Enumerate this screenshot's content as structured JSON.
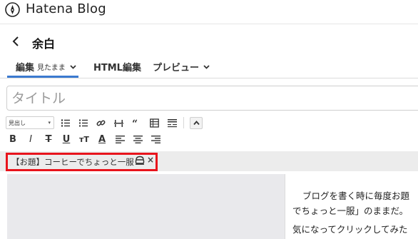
{
  "header": {
    "brand": "Hatena Blog",
    "icon": "hatena-pen-icon"
  },
  "page": {
    "title": "余白",
    "back_icon": "chevron-left-icon"
  },
  "tabs": [
    {
      "label": "編集",
      "sub": "見たまま",
      "active": true
    },
    {
      "label": "HTML編集",
      "active": false
    },
    {
      "label": "プレビュー",
      "active": false
    }
  ],
  "editor": {
    "title_placeholder": "タイトル",
    "heading_select": "見出し",
    "accent_color": "#3b7ad0",
    "highlight_color": "#e8141c"
  },
  "toolbar": {
    "row1": [
      "bulleted-list-icon",
      "numbered-list-icon",
      "link-icon",
      "separator-icon",
      "quote-icon",
      "table-icon",
      "more-icon",
      "collapse-icon"
    ],
    "row2": {
      "bold": "B",
      "italic": "I",
      "strike": "T",
      "underline": "U",
      "font_size": "тT",
      "color": "A",
      "icons": [
        "align-left-icon",
        "align-center-icon",
        "align-right-icon"
      ]
    }
  },
  "topic_tag": {
    "label": "【お題】コーヒーでちょっと一服",
    "icon": "coffee-cup-icon",
    "close": "×"
  },
  "content": {
    "line1": "ブログを書く時に毎度お題",
    "line2": "でちょっと一服」のままだ。",
    "line3": "気になってクリックしてみた"
  }
}
